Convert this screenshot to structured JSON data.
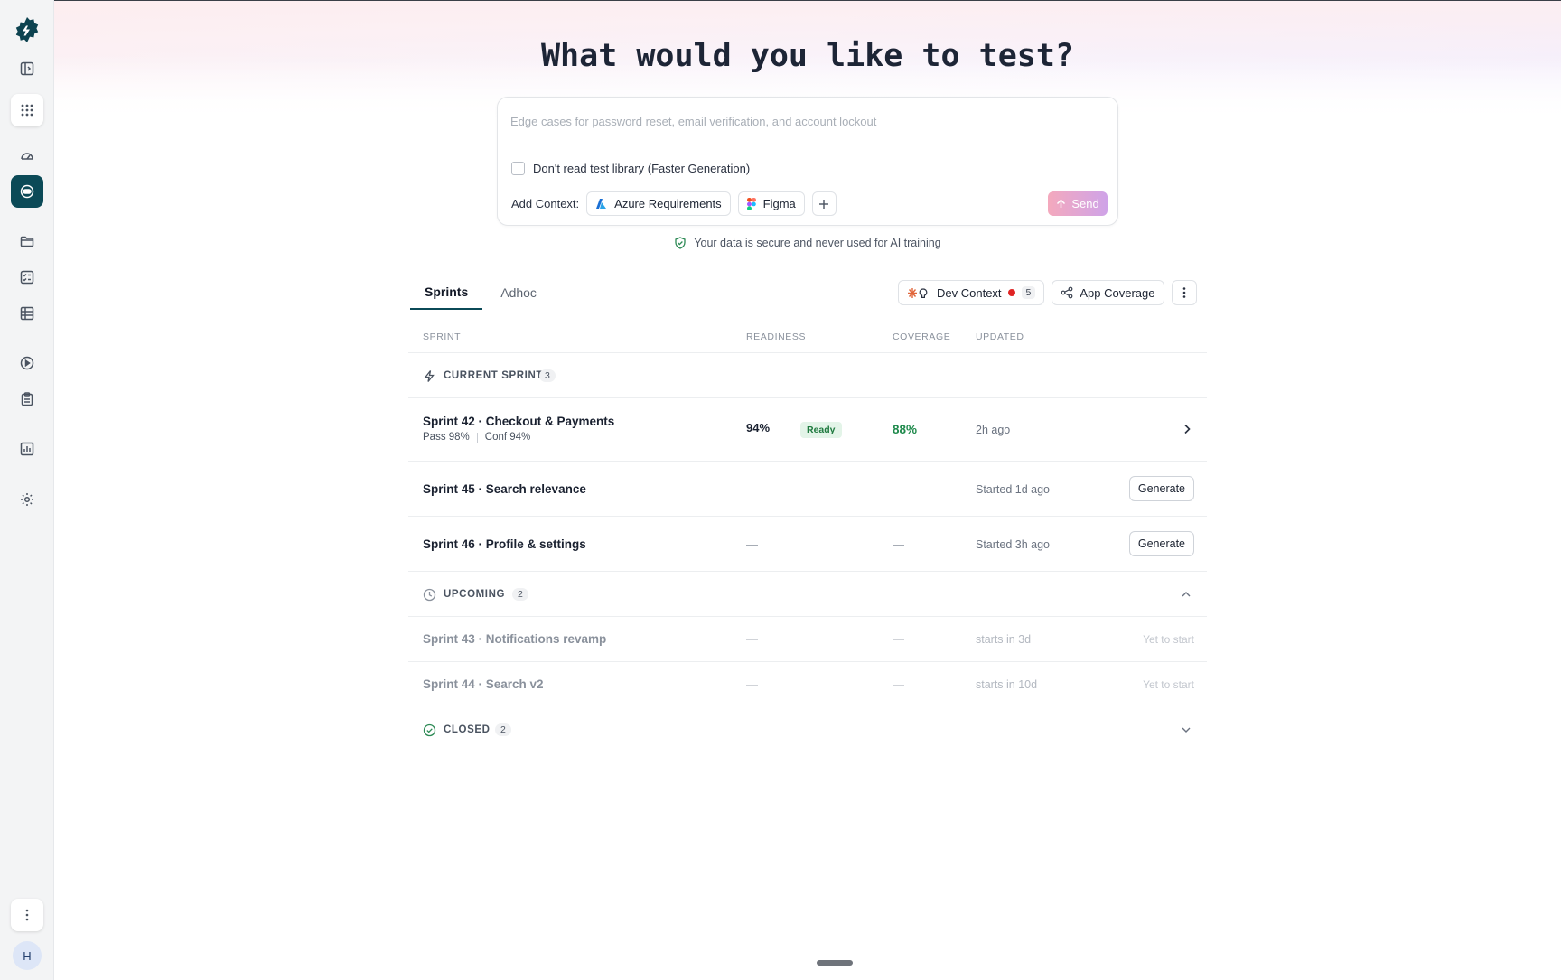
{
  "sidebar": {
    "avatar_initial": "H",
    "items": [
      "logo-gear-icon",
      "panel-toggle-icon",
      "apps-grid-icon",
      "dashboard-icon",
      "ai-agent-icon",
      "folder-icon",
      "checklist-icon",
      "table-icon",
      "play-icon",
      "clipboard-icon",
      "reports-icon",
      "settings-icon",
      "more-vertical-icon"
    ],
    "active_color": "#0b4a57"
  },
  "hero": {
    "title": "What would you like to test?"
  },
  "prompt": {
    "placeholder": "Edge cases for password reset, email verification, and account lockout",
    "checkbox_label": "Don't read test library (Faster Generation)",
    "add_context_label": "Add Context:",
    "contexts": [
      "Azure Requirements",
      "Figma"
    ],
    "send_label": "Send"
  },
  "secure_note": "Your data is secure and never used for AI training",
  "tabs": [
    "Sprints",
    "Adhoc"
  ],
  "toolbar": {
    "dev_context_label": "Dev Context",
    "dev_context_count": "5",
    "app_coverage_label": "App Coverage"
  },
  "table": {
    "headers": [
      "SPRINT",
      "READINESS",
      "COVERAGE",
      "UPDATED"
    ],
    "groups": {
      "current": {
        "label": "CURRENT SPRINTS",
        "count": "3"
      },
      "upcoming": {
        "label": "UPCOMING",
        "count": "2"
      },
      "closed": {
        "label": "CLOSED",
        "count": "2"
      }
    },
    "current_rows": [
      {
        "name": "Sprint 42 · Checkout & Payments",
        "pass": "Pass 98%",
        "conf": "Conf 94%",
        "readiness": "94%",
        "badge": "Ready",
        "coverage": "88%",
        "updated": "2h ago"
      },
      {
        "name": "Sprint 45 · Search relevance",
        "readiness": "—",
        "coverage": "—",
        "updated": "Started 1d ago",
        "action": "Generate"
      },
      {
        "name": "Sprint 46 · Profile & settings",
        "readiness": "—",
        "coverage": "—",
        "updated": "Started 3h ago",
        "action": "Generate"
      }
    ],
    "upcoming_rows": [
      {
        "name": "Sprint 43 · Notifications revamp",
        "readiness": "—",
        "coverage": "—",
        "updated": "starts in 3d",
        "status": "Yet to start"
      },
      {
        "name": "Sprint 44 · Search v2",
        "readiness": "—",
        "coverage": "—",
        "updated": "starts in 10d",
        "status": "Yet to start"
      }
    ]
  }
}
